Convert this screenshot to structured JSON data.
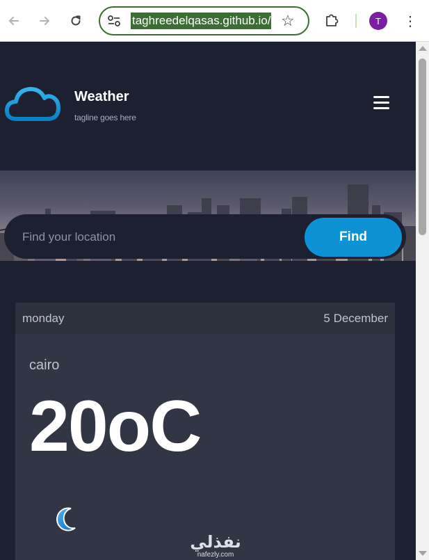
{
  "browser": {
    "url": "taghreedelqasas.github.io/",
    "avatar_initial": "T",
    "icons": [
      "back-arrow-icon",
      "forward-arrow-icon",
      "reload-icon",
      "site-info-icon",
      "bookmark-star-icon",
      "extensions-puzzle-icon",
      "kebab-menu-icon"
    ]
  },
  "header": {
    "title": "Weather",
    "tagline": "tagline goes here",
    "logo_icon": "cloud-icon",
    "menu_icon": "hamburger-menu-icon"
  },
  "search": {
    "placeholder": "Find your location",
    "value": "",
    "button_label": "Find"
  },
  "forecast": {
    "day": "monday",
    "date": "5 December",
    "city": "cairo",
    "temperature": "20oC",
    "condition_icon": "moon-icon"
  },
  "watermark": {
    "arabic": "نفذلي",
    "latin": "nafezly.com"
  },
  "colors": {
    "page_bg": "#1d2031",
    "card_bg": "#323544",
    "card_header_bg": "#2d303d",
    "accent_blue": "#0d92d6",
    "omnibox_border": "#3c6e2f",
    "avatar_purple": "#7b1fa2"
  }
}
